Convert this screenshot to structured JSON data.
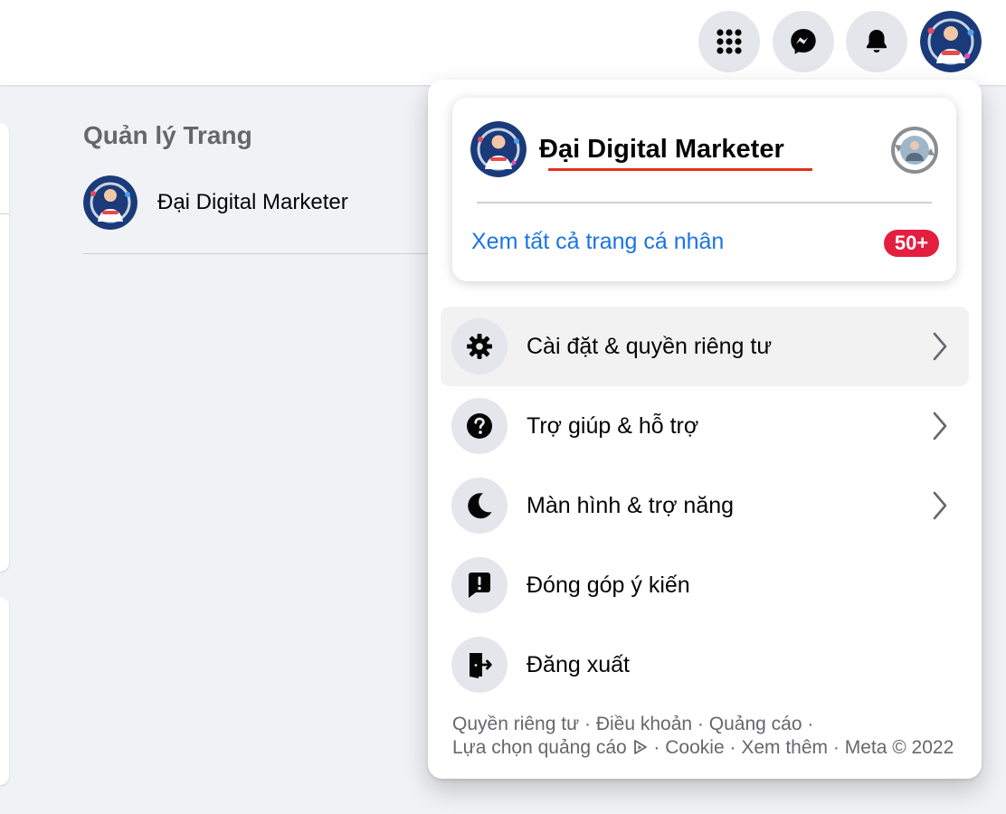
{
  "topbar": {
    "menu_icon": "grid-menu-icon",
    "messenger_icon": "messenger-icon",
    "notifications_icon": "bell-icon"
  },
  "manage_pages": {
    "title": "Quản lý Trang",
    "page_name": "Đại Digital Marketer"
  },
  "account_menu": {
    "profile": {
      "name": "Đại Digital Marketer",
      "see_all": "Xem tất cả trang cá nhân",
      "badge": "50+"
    },
    "items": [
      {
        "label": "Cài đặt & quyền riêng tư",
        "icon": "gear-icon",
        "has_chevron": true
      },
      {
        "label": "Trợ giúp & hỗ trợ",
        "icon": "help-icon",
        "has_chevron": true
      },
      {
        "label": "Màn hình & trợ năng",
        "icon": "moon-icon",
        "has_chevron": true
      },
      {
        "label": "Đóng góp ý kiến",
        "icon": "feedback-icon",
        "has_chevron": false
      },
      {
        "label": "Đăng xuất",
        "icon": "logout-icon",
        "has_chevron": false
      }
    ],
    "footer": {
      "privacy": "Quyền riêng tư",
      "terms": "Điều khoản",
      "ads": "Quảng cáo",
      "ad_choices": "Lựa chọn quảng cáo",
      "cookies": "Cookie",
      "more": "Xem thêm",
      "copyright": "Meta © 2022",
      "separator": "·"
    }
  },
  "colors": {
    "link": "#1b74e4",
    "badge": "#e41e3f",
    "underline": "#e2321b",
    "icon_bg": "#e4e6eb"
  }
}
